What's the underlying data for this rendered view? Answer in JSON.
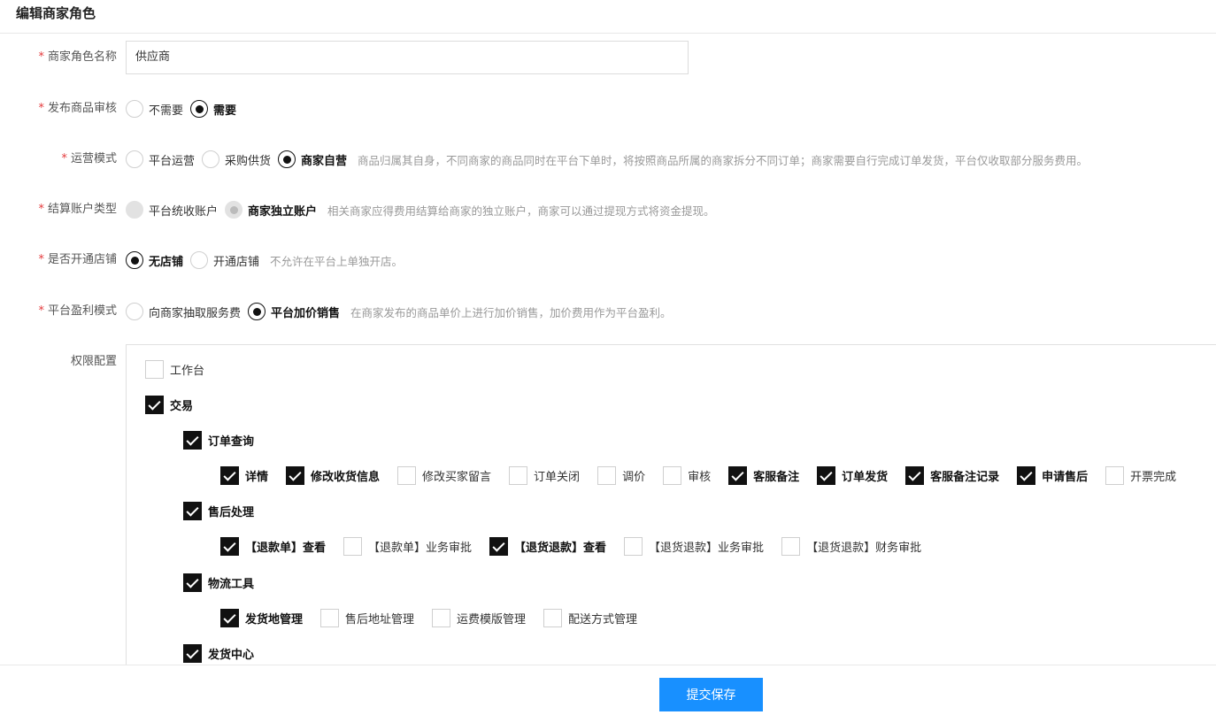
{
  "page": {
    "title": "编辑商家角色"
  },
  "fields": {
    "name": {
      "label": "商家角色名称",
      "value": "供应商"
    },
    "review": {
      "label": "发布商品审核",
      "options": [
        "不需要",
        "需要"
      ],
      "selected": 1
    },
    "operation": {
      "label": "运营模式",
      "options": [
        "平台运营",
        "采购供货",
        "商家自营"
      ],
      "selected": 2,
      "hint": "商品归属其自身，不同商家的商品同时在平台下单时，将按照商品所属的商家拆分不同订单；商家需要自行完成订单发货，平台仅收取部分服务费用。"
    },
    "settlement": {
      "label": "结算账户类型",
      "options": [
        "平台统收账户",
        "商家独立账户"
      ],
      "selected": 1,
      "hint": "相关商家应得费用结算给商家的独立账户，商家可以通过提现方式将资金提现。"
    },
    "store": {
      "label": "是否开通店铺",
      "options": [
        "无店铺",
        "开通店铺"
      ],
      "selected": 0,
      "hint": "不允许在平台上单独开店。"
    },
    "profit": {
      "label": "平台盈利模式",
      "options": [
        "向商家抽取服务费",
        "平台加价销售"
      ],
      "selected": 1,
      "hint": "在商家发布的商品单价上进行加价销售，加价费用作为平台盈利。"
    }
  },
  "permissions": {
    "label": "权限配置",
    "workbench": {
      "label": "工作台",
      "checked": false
    },
    "trade": {
      "label": "交易",
      "checked": true
    },
    "order_query": {
      "label": "订单查询",
      "checked": true,
      "items": [
        {
          "label": "详情",
          "checked": true
        },
        {
          "label": "修改收货信息",
          "checked": true
        },
        {
          "label": "修改买家留言",
          "checked": false
        },
        {
          "label": "订单关闭",
          "checked": false
        },
        {
          "label": "调价",
          "checked": false
        },
        {
          "label": "审核",
          "checked": false
        },
        {
          "label": "客服备注",
          "checked": true
        },
        {
          "label": "订单发货",
          "checked": true
        },
        {
          "label": "客服备注记录",
          "checked": true
        },
        {
          "label": "申请售后",
          "checked": true
        },
        {
          "label": "开票完成",
          "checked": false
        }
      ]
    },
    "after_sales": {
      "label": "售后处理",
      "checked": true,
      "items": [
        {
          "label": "【退款单】查看",
          "checked": true
        },
        {
          "label": "【退款单】业务审批",
          "checked": false
        },
        {
          "label": "【退货退款】查看",
          "checked": true
        },
        {
          "label": "【退货退款】业务审批",
          "checked": false
        },
        {
          "label": "【退货退款】财务审批",
          "checked": false
        }
      ]
    },
    "logistics": {
      "label": "物流工具",
      "checked": true,
      "items": [
        {
          "label": "发货地管理",
          "checked": true
        },
        {
          "label": "售后地址管理",
          "checked": false
        },
        {
          "label": "运费模版管理",
          "checked": false
        },
        {
          "label": "配送方式管理",
          "checked": false
        }
      ]
    },
    "shipping_center": {
      "label": "发货中心",
      "checked": true
    }
  },
  "footer": {
    "submit_label": "提交保存"
  },
  "colors": {
    "primary": "#1890ff",
    "required": "#e4393c",
    "check": "#111111"
  }
}
